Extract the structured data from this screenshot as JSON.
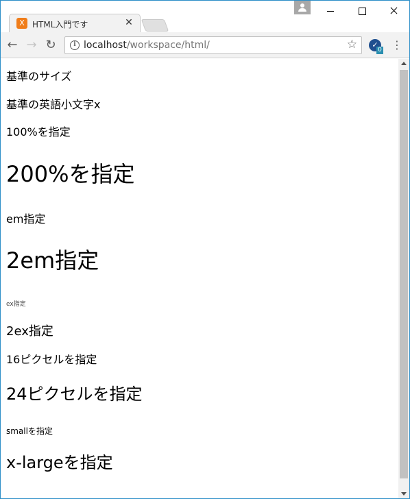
{
  "browser": {
    "tab": {
      "favicon": "X",
      "title": "HTML入門です",
      "close_glyph": "✕"
    },
    "controls": {
      "minimize": "minimize-icon",
      "maximize": "maximize-icon",
      "close": "close-icon"
    },
    "nav": {
      "back": "←",
      "forward": "→",
      "reload": "↻"
    },
    "omnibox": {
      "info_glyph": "i",
      "host": "localhost",
      "path": "/workspace/html/",
      "star": "☆"
    },
    "extension": {
      "glyph": "✓",
      "badge": "0"
    },
    "menu_glyph": "⋮"
  },
  "page": {
    "lines": [
      "基準のサイズ",
      "基準の英語小文字x",
      "100%を指定",
      "200%を指定",
      "em指定",
      "2em指定",
      "ex指定",
      "2ex指定",
      "16ピクセルを指定",
      "24ピクセルを指定",
      "smallを指定",
      "x-largeを指定"
    ]
  },
  "colors": {
    "window_border": "#2b8ec8",
    "favicon": "#f07d1a",
    "toolbar": "#f2f2f2"
  }
}
